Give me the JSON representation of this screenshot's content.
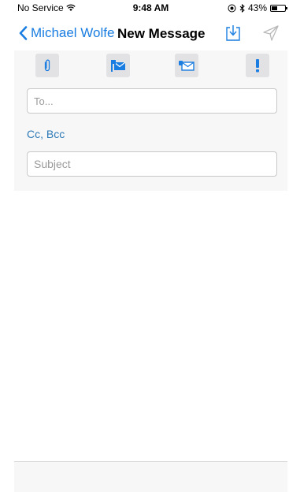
{
  "status_bar": {
    "carrier": "No Service",
    "time": "9:48 AM",
    "battery_percent": "43%",
    "battery_level": 0.43,
    "icons": [
      "wifi-icon",
      "location-icon",
      "bluetooth-icon",
      "battery-icon"
    ]
  },
  "nav": {
    "back_label": "Michael Wolfe",
    "title": "New Message",
    "save_icon": "save-draft-icon",
    "send_icon": "send-icon"
  },
  "toolbar": {
    "buttons": [
      {
        "name": "attachment-icon"
      },
      {
        "name": "request-read-receipt-icon"
      },
      {
        "name": "request-delivery-receipt-icon"
      },
      {
        "name": "high-priority-icon",
        "label": "!"
      }
    ]
  },
  "compose": {
    "to_placeholder": "To...",
    "cc_bcc_label": "Cc, Bcc",
    "subject_placeholder": "Subject"
  },
  "colors": {
    "accent": "#1a7de1",
    "link": "#2d7ab8",
    "header_bg": "#f7f7f7",
    "tool_btn_bg": "#e2e2e4"
  }
}
